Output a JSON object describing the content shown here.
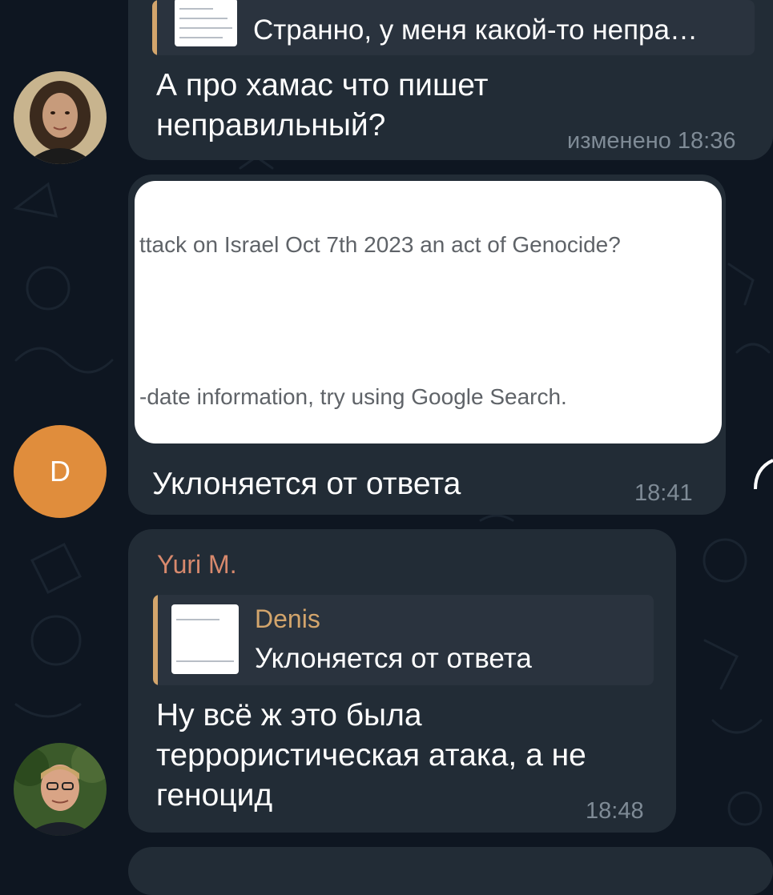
{
  "theme": {
    "background": "#0e1621",
    "bubble": "#222c36",
    "reply_bg": "#2a333e",
    "reply_accent": "#d3a56c",
    "author_color": "#d8896d",
    "text": "#ffffff",
    "meta_text": "#7f8b96"
  },
  "messages": [
    {
      "reply": {
        "text": "Странно, у меня какой-то непра…"
      },
      "text": "А про хамас что пишет\nнеправильный?",
      "time": "изменено 18:36"
    },
    {
      "avatar_letter": "D",
      "photo": {
        "line1": "ttack on Israel Oct 7th 2023 an act of Genocide?",
        "line2": "-date information, try using Google Search."
      },
      "text": "Уклоняется от ответа",
      "time": "18:41"
    },
    {
      "author": "Yuri M.",
      "reply": {
        "author": "Denis",
        "text": "Уклоняется от ответа"
      },
      "text": "Ну всё ж это была\nтеррористическая атака, а не\nгеноцид",
      "time": "18:48"
    }
  ]
}
